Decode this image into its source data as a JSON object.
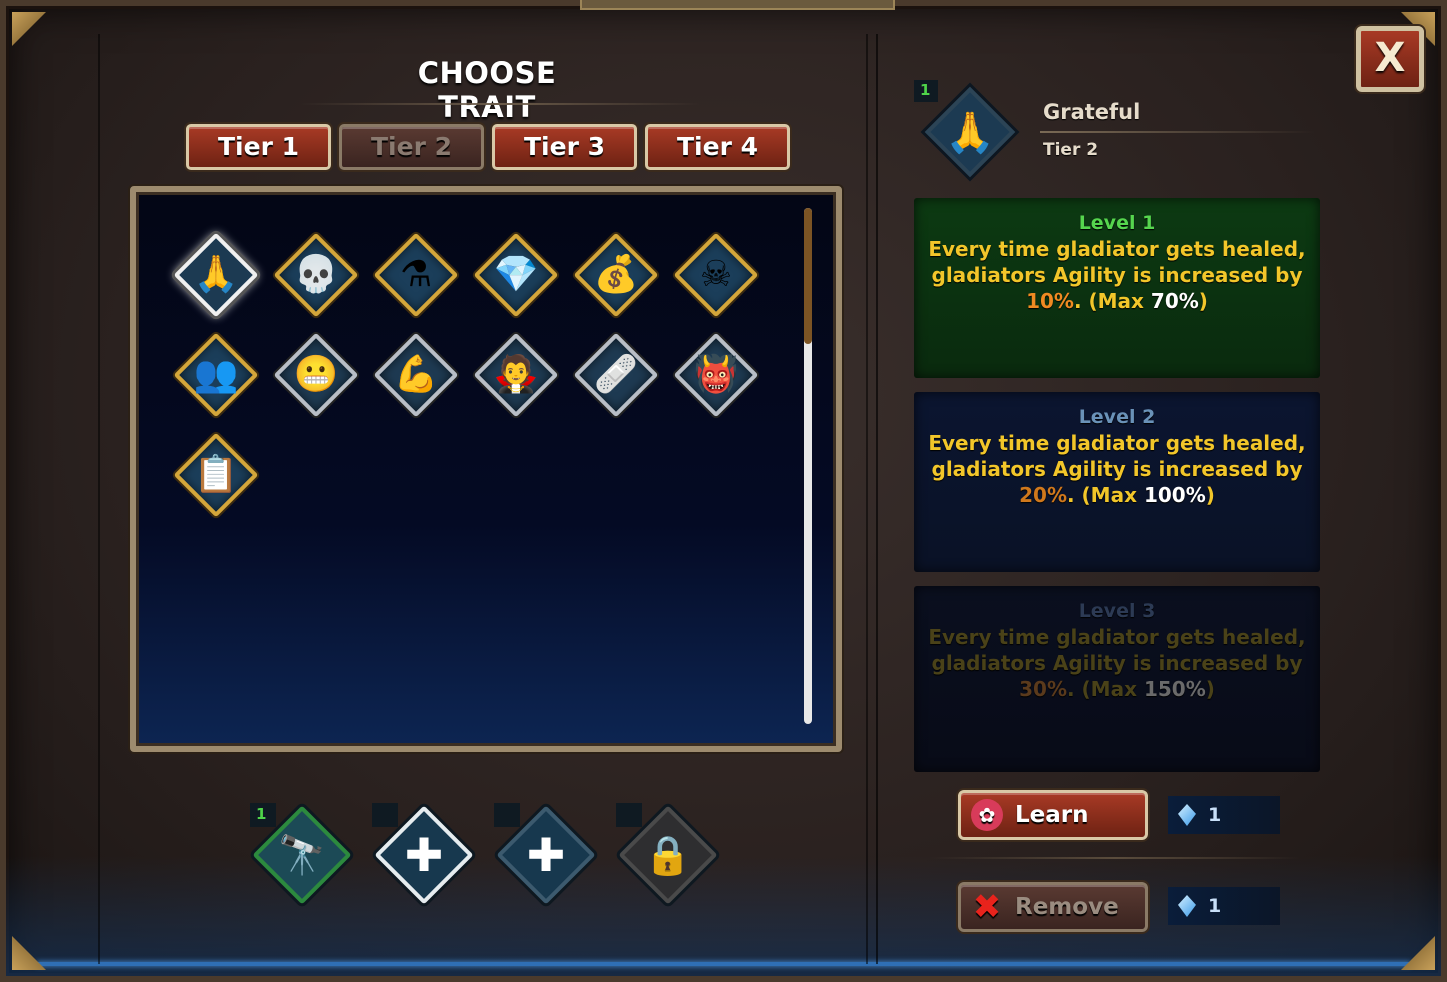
{
  "title": "CHOOSE TRAIT",
  "close_label": "X",
  "tiers": [
    {
      "label": "Tier 1",
      "active": false
    },
    {
      "label": "Tier 2",
      "active": true
    },
    {
      "label": "Tier 3",
      "active": false
    },
    {
      "label": "Tier 4",
      "active": false
    }
  ],
  "traits": [
    {
      "icon": "praying-hands-icon",
      "glyph": "🙏",
      "frame": "white"
    },
    {
      "icon": "skull-icon",
      "glyph": "💀",
      "frame": "gold"
    },
    {
      "icon": "potion-bag-icon",
      "glyph": "⚗",
      "frame": "gold"
    },
    {
      "icon": "crystal-icon",
      "glyph": "💎",
      "frame": "gold"
    },
    {
      "icon": "gold-coins-icon",
      "glyph": "💰",
      "frame": "gold"
    },
    {
      "icon": "skulls-pile-icon",
      "glyph": "☠",
      "frame": "gold"
    },
    {
      "icon": "green-crowd-icon",
      "glyph": "👥",
      "frame": "gold"
    },
    {
      "icon": "angry-face-icon",
      "glyph": "😬",
      "frame": "silver"
    },
    {
      "icon": "gladiator-arm-icon",
      "glyph": "💪",
      "frame": "silver"
    },
    {
      "icon": "vampire-icon",
      "glyph": "🧛",
      "frame": "silver"
    },
    {
      "icon": "bandaged-torso-icon",
      "glyph": "🩹",
      "frame": "silver"
    },
    {
      "icon": "demon-mask-icon",
      "glyph": "👹",
      "frame": "silver"
    },
    {
      "icon": "tactics-board-icon",
      "glyph": "📋",
      "frame": "gold"
    }
  ],
  "slots": [
    {
      "icon": "cannon-icon",
      "glyph": "🔭",
      "badge": "1"
    },
    {
      "icon": "plus-icon",
      "glyph": "✚",
      "badge": ""
    },
    {
      "icon": "plus-icon",
      "glyph": "✚",
      "badge": ""
    },
    {
      "icon": "padlock-icon",
      "glyph": "🔒",
      "badge": ""
    }
  ],
  "selected": {
    "name": "Grateful",
    "tier": "Tier 2",
    "badge": "1",
    "glyph": "🙏"
  },
  "levels": [
    {
      "title": "Level 1",
      "line1": "Every time gladiator gets healed,",
      "line2": "gladiators Agility is increased by",
      "pct": "10%",
      "rest": ". (Max ",
      "max": "70%",
      "close": ")"
    },
    {
      "title": "Level 2",
      "line1": "Every time gladiator gets healed,",
      "line2": "gladiators Agility is increased by",
      "pct": "20%",
      "rest": ". (Max ",
      "max": "100%",
      "close": ")"
    },
    {
      "title": "Level 3",
      "line1": "Every time gladiator gets healed,",
      "line2": "gladiators Agility is increased by",
      "pct": "30%",
      "rest": ". (Max ",
      "max": "150%",
      "close": ")"
    }
  ],
  "actions": {
    "learn_label": "Learn",
    "learn_cost": "1",
    "remove_label": "Remove",
    "remove_cost": "1"
  },
  "colors": {
    "button_red": "#a83a25",
    "gold_text": "#f2c62a",
    "level1_green": "#56d64e"
  }
}
